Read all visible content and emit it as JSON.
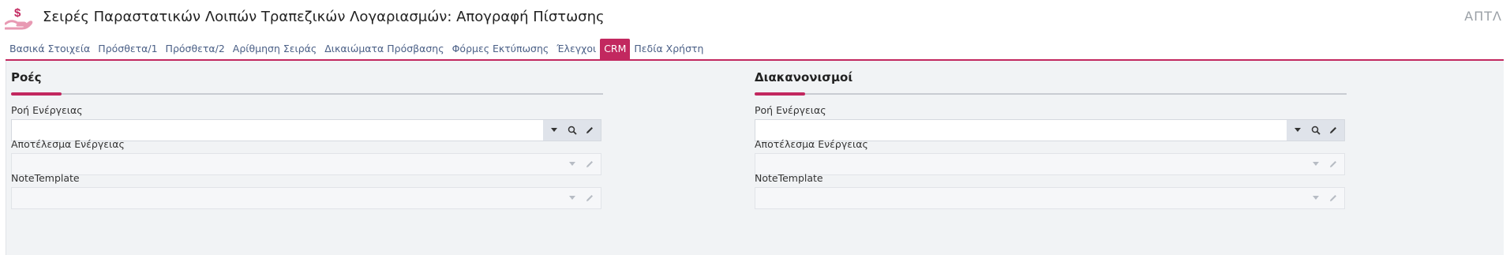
{
  "header": {
    "title": "Σειρές Παραστατικών Λοιπών Τραπεζικών Λογαριασμών: Απογραφή Πίστωσης",
    "right_label": "ΑΠΤΛ"
  },
  "tabs": [
    {
      "label": "Βασικά Στοιχεία"
    },
    {
      "label": "Πρόσθετα/1"
    },
    {
      "label": "Πρόσθετα/2"
    },
    {
      "label": "Αρίθμηση Σειράς"
    },
    {
      "label": "Δικαιώματα Πρόσβασης"
    },
    {
      "label": "Φόρμες Εκτύπωσης"
    },
    {
      "label": "Έλεγχοι"
    },
    {
      "label": "CRM"
    },
    {
      "label": "Πεδία Χρήστη"
    }
  ],
  "active_tab": "CRM",
  "sections": {
    "left": {
      "title": "Ροές",
      "fields": [
        {
          "label": "Ροή Ενέργειας",
          "value": ""
        },
        {
          "label": "Αποτέλεσμα Ενέργειας",
          "value": ""
        },
        {
          "label": "NoteTemplate",
          "value": ""
        }
      ]
    },
    "right": {
      "title": "Διακανονισμοί",
      "fields": [
        {
          "label": "Ροή Ενέργειας",
          "value": ""
        },
        {
          "label": "Αποτέλεσμα Ενέργειας",
          "value": ""
        },
        {
          "label": "NoteTemplate",
          "value": ""
        }
      ]
    }
  },
  "colors": {
    "accent": "#c2285f",
    "tab_text": "#4a5f86",
    "panel_bg": "#f1f3f5"
  },
  "icons": [
    "money-hand-icon",
    "dropdown-arrow-icon",
    "search-icon",
    "edit-pencil-icon"
  ]
}
